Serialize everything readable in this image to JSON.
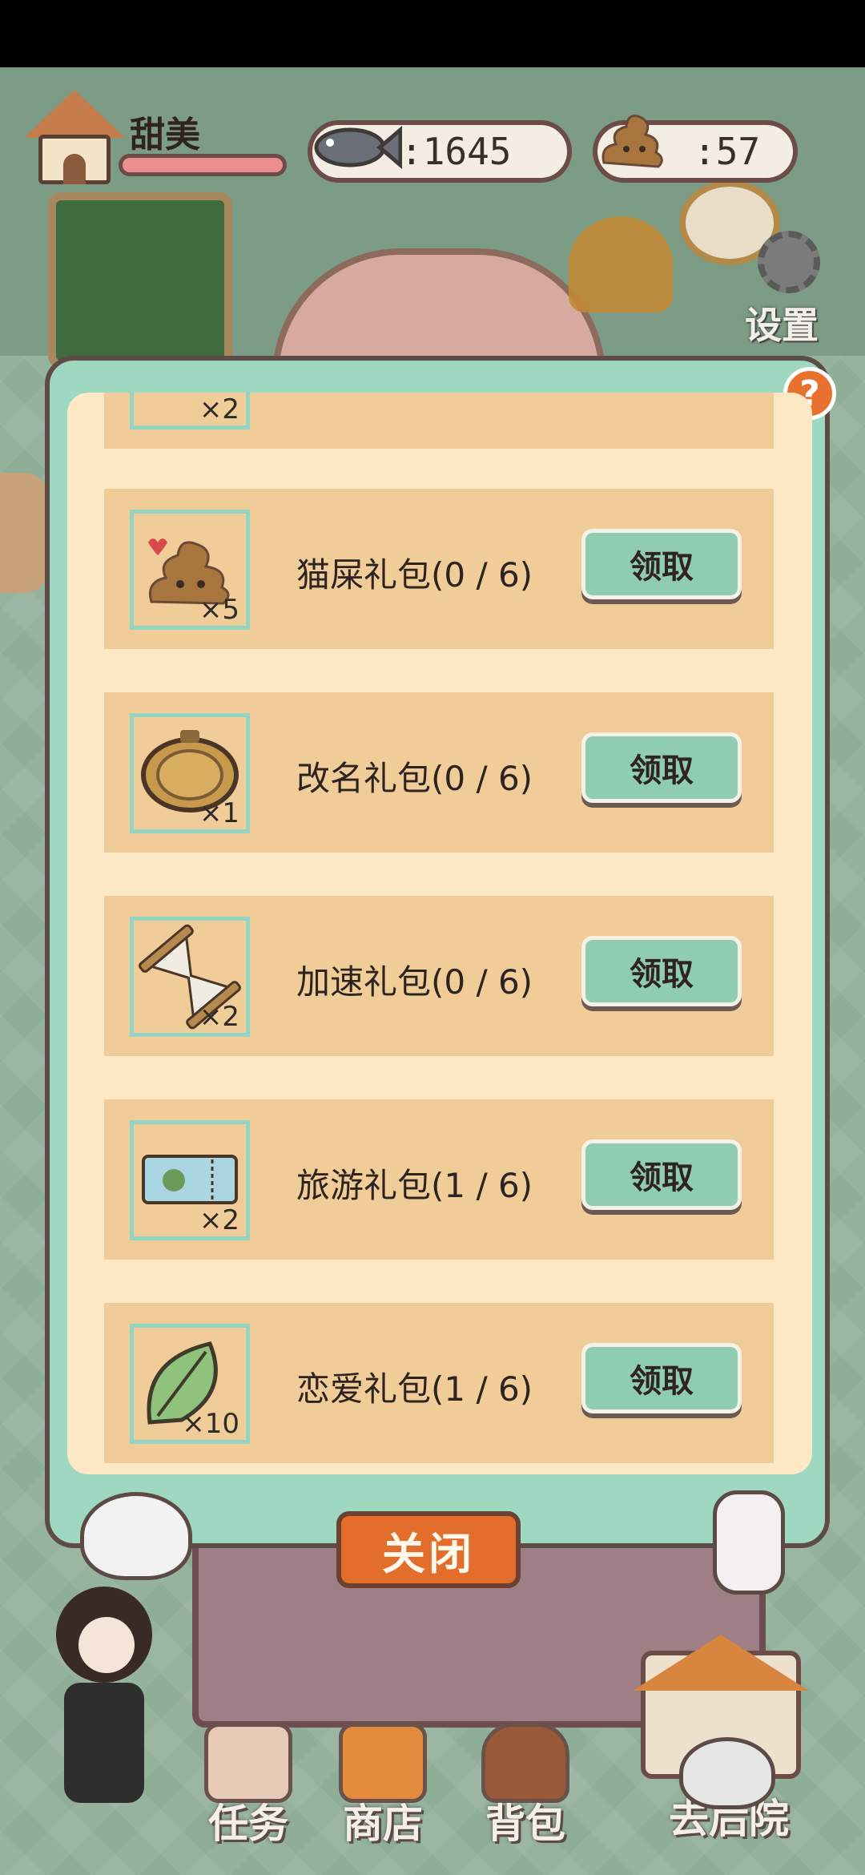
{
  "player": {
    "name": "甜美"
  },
  "resources": {
    "fish": ":1645",
    "poop": ":57"
  },
  "settings": {
    "label": "设置"
  },
  "modal": {
    "help_label": "?",
    "rows": [
      {
        "count": "×5",
        "label": "猫屎礼包(0 / 6)",
        "button": "领取"
      },
      {
        "count": "×1",
        "label": "改名礼包(0 / 6)",
        "button": "领取"
      },
      {
        "count": "×2",
        "label": "加速礼包(0 / 6)",
        "button": "领取"
      },
      {
        "count": "×2",
        "label": "旅游礼包(1 / 6)",
        "button": "领取"
      },
      {
        "count": "×10",
        "label": "恋爱礼包(1 / 6)",
        "button": "领取"
      }
    ],
    "partial_row": {
      "count": "×2"
    },
    "close_label": "关闭"
  },
  "nav": {
    "tasks": "任务",
    "shop": "商店",
    "bag": "背包",
    "backyard": "去后院"
  },
  "colors": {
    "accent_mint": "#9fd8c0",
    "panel_cream": "#fde8c6",
    "row_tan": "#f0cd98",
    "close_orange": "#e36e2b"
  }
}
